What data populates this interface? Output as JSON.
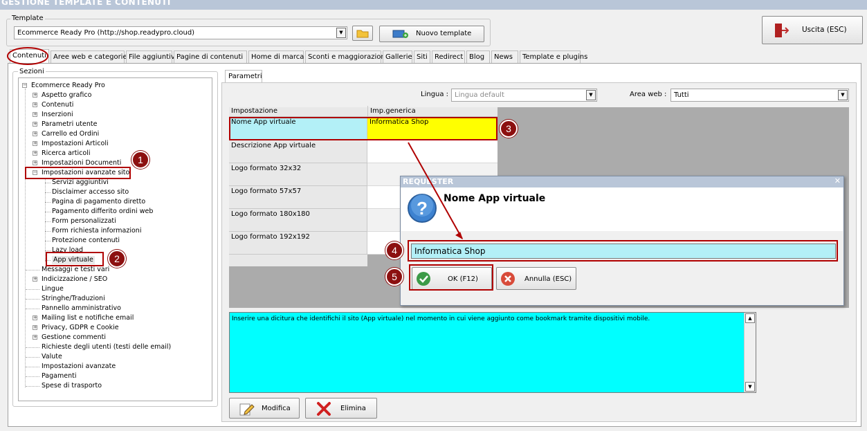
{
  "window": {
    "title": "GESTIONE TEMPLATE E CONTENUTI"
  },
  "template": {
    "group_label": "Template",
    "selected": "Ecommerce Ready Pro (http://shop.readypro.cloud)",
    "new_template_label": "Nuovo template",
    "exit_label": "Uscita (ESC)"
  },
  "tabs": [
    {
      "label": "Contenuti",
      "active": true
    },
    {
      "label": "Aree web e categorie"
    },
    {
      "label": "File aggiuntivi"
    },
    {
      "label": "Pagine di contenuti"
    },
    {
      "label": "Home di marca"
    },
    {
      "label": "Sconti e maggiorazioni"
    },
    {
      "label": "Gallerie"
    },
    {
      "label": "Siti"
    },
    {
      "label": "Redirect"
    },
    {
      "label": "Blog"
    },
    {
      "label": "News"
    },
    {
      "label": "Template e plugins"
    }
  ],
  "sections": {
    "label": "Sezioni",
    "root": "Ecommerce Ready Pro",
    "items": [
      {
        "label": "Aspetto grafico",
        "expander": "+"
      },
      {
        "label": "Contenuti",
        "expander": "+"
      },
      {
        "label": "Inserzioni",
        "expander": "+"
      },
      {
        "label": "Parametri utente",
        "expander": "+"
      },
      {
        "label": "Carrello ed Ordini",
        "expander": "+"
      },
      {
        "label": "Impostazioni Articoli",
        "expander": "+"
      },
      {
        "label": "Ricerca articoli",
        "expander": "+"
      },
      {
        "label": "Impostazioni Documenti",
        "expander": "+"
      },
      {
        "label": "Impostazioni avanzate sito",
        "expander": "−"
      },
      {
        "label": "Servizi aggiuntivi",
        "child": true
      },
      {
        "label": "Disclaimer accesso sito",
        "child": true
      },
      {
        "label": "Pagina di pagamento diretto",
        "child": true
      },
      {
        "label": "Pagamento differito ordini web",
        "child": true
      },
      {
        "label": "Form personalizzati",
        "child": true
      },
      {
        "label": "Form richiesta informazioni",
        "child": true
      },
      {
        "label": "Protezione contenuti",
        "child": true
      },
      {
        "label": "Lazy load",
        "child": true
      },
      {
        "label": "App virtuale",
        "child": true,
        "selected": true
      },
      {
        "label": "Messaggi e testi vari"
      },
      {
        "label": "Indicizzazione / SEO",
        "expander": "+"
      },
      {
        "label": "Lingue"
      },
      {
        "label": "Stringhe/Traduzioni"
      },
      {
        "label": "Pannello amministrativo"
      },
      {
        "label": "Mailing list e notifiche email",
        "expander": "+"
      },
      {
        "label": "Privacy, GDPR e Cookie",
        "expander": "+"
      },
      {
        "label": "Gestione commenti",
        "expander": "+"
      },
      {
        "label": "Richieste degli utenti (testi delle email)"
      },
      {
        "label": "Valute"
      },
      {
        "label": "Impostazioni avanzate"
      },
      {
        "label": "Pagamenti"
      },
      {
        "label": "Spese di trasporto"
      }
    ]
  },
  "params": {
    "tab_label": "Parametri",
    "lingua_label": "Lingua :",
    "lingua_value": "Lingua default",
    "area_label": "Area web :",
    "area_value": "Tutti",
    "col_setting": "Impostazione",
    "col_generic": "Imp.generica",
    "rows": [
      {
        "setting": "Nome App virtuale",
        "value": "Informatica Shop"
      },
      {
        "setting": "Descrizione App virtuale",
        "value": ""
      },
      {
        "setting": "Logo formato 32x32",
        "value": ""
      },
      {
        "setting": "Logo formato 57x57",
        "value": ""
      },
      {
        "setting": "Logo formato 180x180",
        "value": ""
      },
      {
        "setting": "Logo formato 192x192",
        "value": ""
      }
    ],
    "description": "Inserire una dicitura che identifichi il sito (App virtuale) nel momento in cui viene aggiunto come bookmark tramite dispositivi mobile.",
    "modify_label": "Modifica",
    "delete_label": "Elimina"
  },
  "requester": {
    "title": "REQUESTER",
    "close": "✕",
    "heading": "Nome App virtuale",
    "input_value": "Informatica Shop",
    "ok_label": "OK (F12)",
    "cancel_label": "Annulla (ESC)"
  },
  "markers": [
    "1",
    "2",
    "3",
    "4",
    "5"
  ],
  "colors": {
    "highlight_cyan": "#b3f0f7",
    "highlight_yellow": "#ffff00",
    "annotation_red": "#b00000",
    "marker_fill": "#8c1010",
    "memo_cyan": "#00ffff"
  }
}
